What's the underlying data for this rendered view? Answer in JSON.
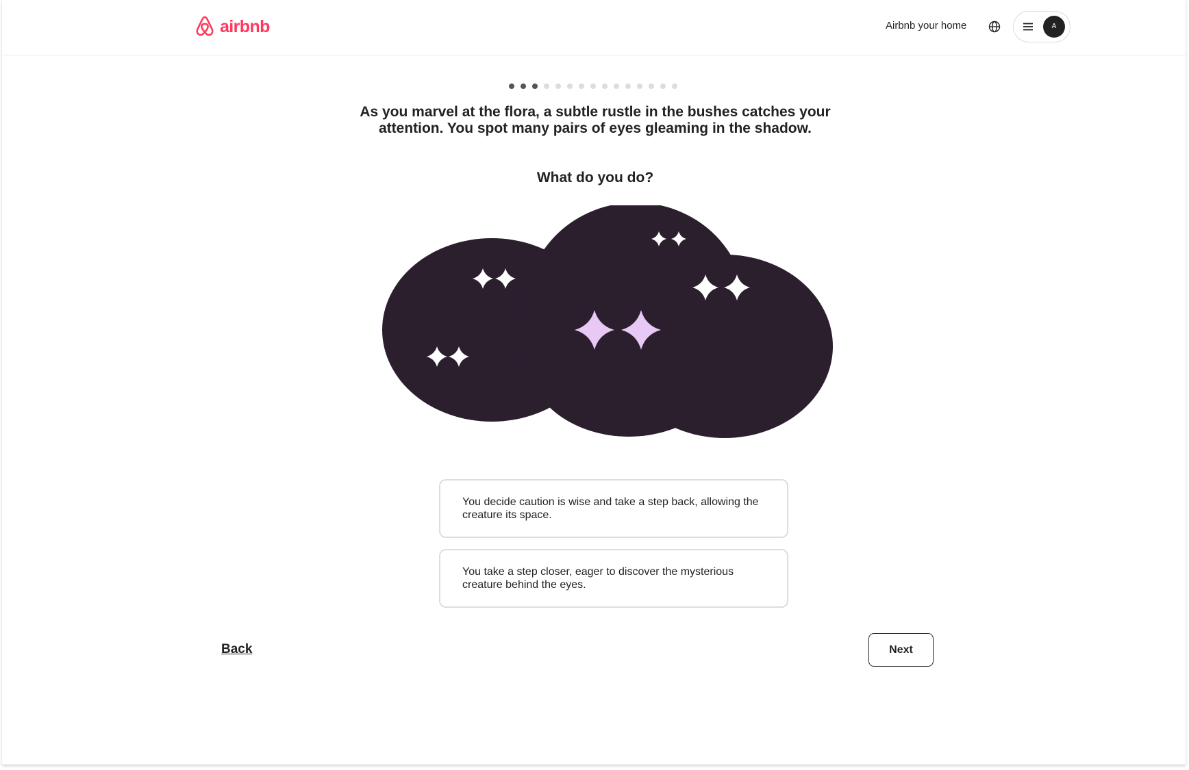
{
  "header": {
    "logo_text": "airbnb",
    "host_link": "Airbnb your home",
    "avatar_initial": "A",
    "icons": [
      "airbnb-logo-icon",
      "globe-icon",
      "menu-icon"
    ]
  },
  "progress": {
    "total_steps": 15,
    "completed_steps": 3
  },
  "question": {
    "text": "As you marvel at the flora, a subtle rustle in the bushes catches your attention. You spot many pairs of eyes gleaming in the shadow.",
    "prompt": "What do you do?"
  },
  "options": [
    {
      "label": "You decide caution is wise  and take a step back, allowing the creature its space."
    },
    {
      "label": "You take a step closer, eager to discover the mysterious creature behind the eyes."
    }
  ],
  "navigation": {
    "back_label": "Back",
    "next_label": "Next"
  },
  "colors": {
    "brand": "#FF385C",
    "cloud": "#2B1F2E",
    "eyes_white": "#FFFFFF",
    "eyes_pink": "#E8C8F4",
    "border": "#DDDDDD",
    "dot_done": "#555555",
    "dot_todo": "#DDDDDD"
  }
}
